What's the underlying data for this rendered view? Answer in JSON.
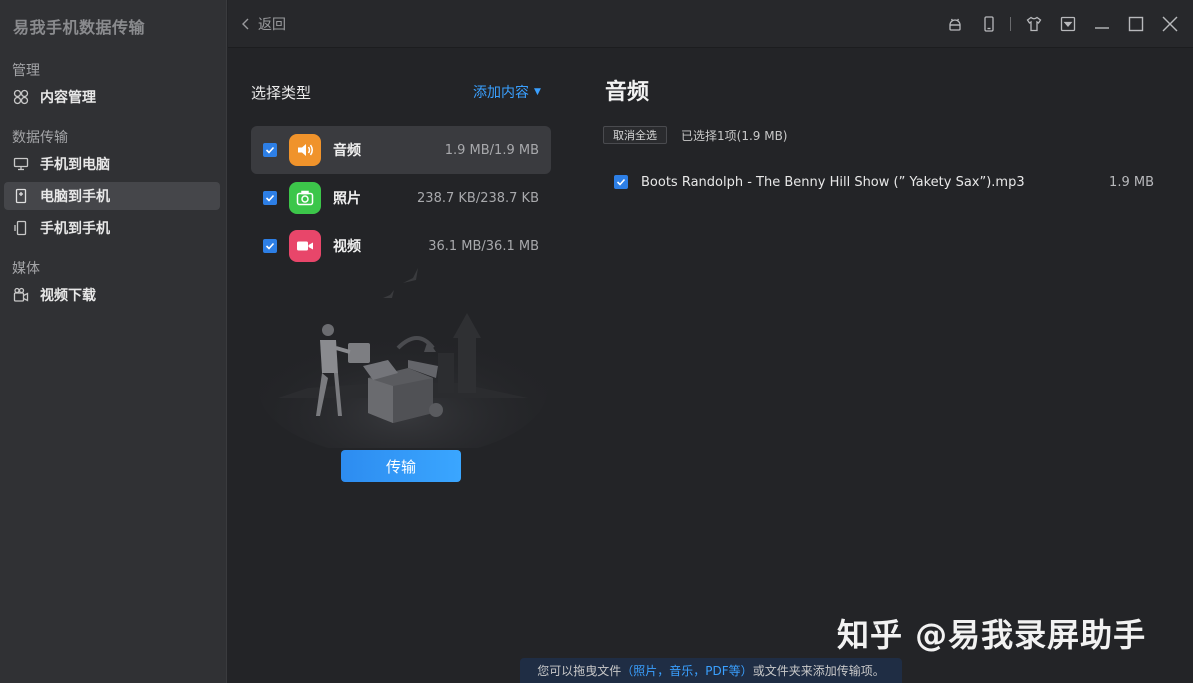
{
  "app": {
    "title": "易我手机数据传输"
  },
  "sidebar": {
    "sections": [
      {
        "title": "管理",
        "items": [
          {
            "label": "内容管理",
            "icon": "grid-circles-icon",
            "active": false
          }
        ]
      },
      {
        "title": "数据传输",
        "items": [
          {
            "label": "手机到电脑",
            "icon": "phone-to-pc-icon",
            "active": false
          },
          {
            "label": "电脑到手机",
            "icon": "pc-to-phone-icon",
            "active": true
          },
          {
            "label": "手机到手机",
            "icon": "phone-to-phone-icon",
            "active": false
          }
        ]
      },
      {
        "title": "媒体",
        "items": [
          {
            "label": "视频下载",
            "icon": "video-download-icon",
            "active": false
          }
        ]
      }
    ]
  },
  "topbar": {
    "back_label": "返回",
    "icons": [
      "android-icon",
      "phone-icon",
      "shirt-icon",
      "menu-dropdown-icon",
      "minimize-icon",
      "maximize-icon",
      "close-icon"
    ]
  },
  "left_panel": {
    "heading": "选择类型",
    "add_content_label": "添加内容",
    "types": [
      {
        "name": "音频",
        "size": "1.9 MB/1.9 MB",
        "icon": "speaker-icon",
        "color": "#f0932b",
        "checked": true,
        "active": true
      },
      {
        "name": "照片",
        "size": "238.7 KB/238.7 KB",
        "icon": "camera-icon",
        "color": "#3cc64a",
        "checked": true,
        "active": false
      },
      {
        "name": "视频",
        "size": "36.1 MB/36.1 MB",
        "icon": "video-camera-icon",
        "color": "#e8466a",
        "checked": true,
        "active": false
      }
    ],
    "transfer_label": "传输"
  },
  "right_panel": {
    "title": "音频",
    "cancel_all_label": "取消全选",
    "selected_info": "已选择1项(1.9 MB)",
    "files": [
      {
        "name": "Boots Randolph - The Benny Hill Show (” Yakety Sax”).mp3",
        "size": "1.9 MB",
        "checked": true
      }
    ]
  },
  "hint": {
    "prefix": "您可以拖曳文件",
    "highlight": "（照片，音乐，PDF等）",
    "suffix": "或文件夹来添加传输项。"
  },
  "watermark": "知乎 @易我录屏助手",
  "colors": {
    "accent": "#2d8cf0",
    "link": "#3aa0ff",
    "sidebar_bg": "#303134",
    "main_bg": "#232427"
  }
}
